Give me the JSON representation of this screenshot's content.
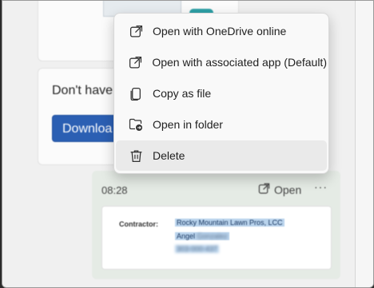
{
  "background_content": {
    "banner_text": "Don't have",
    "download_button": "Downloa",
    "message": {
      "time": "08:28",
      "open_label": "Open",
      "more_label": "···",
      "attachment": {
        "contractor_label": "Contractor:",
        "contractor_name": "Rocky Mountain Lawn Pros, LCC",
        "contact_first": "Angel",
        "contact_last_blurred": "Gonzalez",
        "phone_blurred": "303-000-437"
      }
    }
  },
  "context_menu": {
    "items": [
      {
        "label": "Open with OneDrive online",
        "icon": "open-external-icon"
      },
      {
        "label": "Open with associated app (Default)",
        "icon": "open-external-icon"
      },
      {
        "label": "Copy as file",
        "icon": "copy-icon"
      },
      {
        "label": "Open in folder",
        "icon": "folder-arrow-icon"
      },
      {
        "label": "Delete",
        "icon": "trash-icon",
        "hovered": true
      }
    ]
  },
  "colors": {
    "accent_button": "#2b5fb3",
    "highlight": "#b9d3ec",
    "menu_hover": "#eaeaea"
  }
}
